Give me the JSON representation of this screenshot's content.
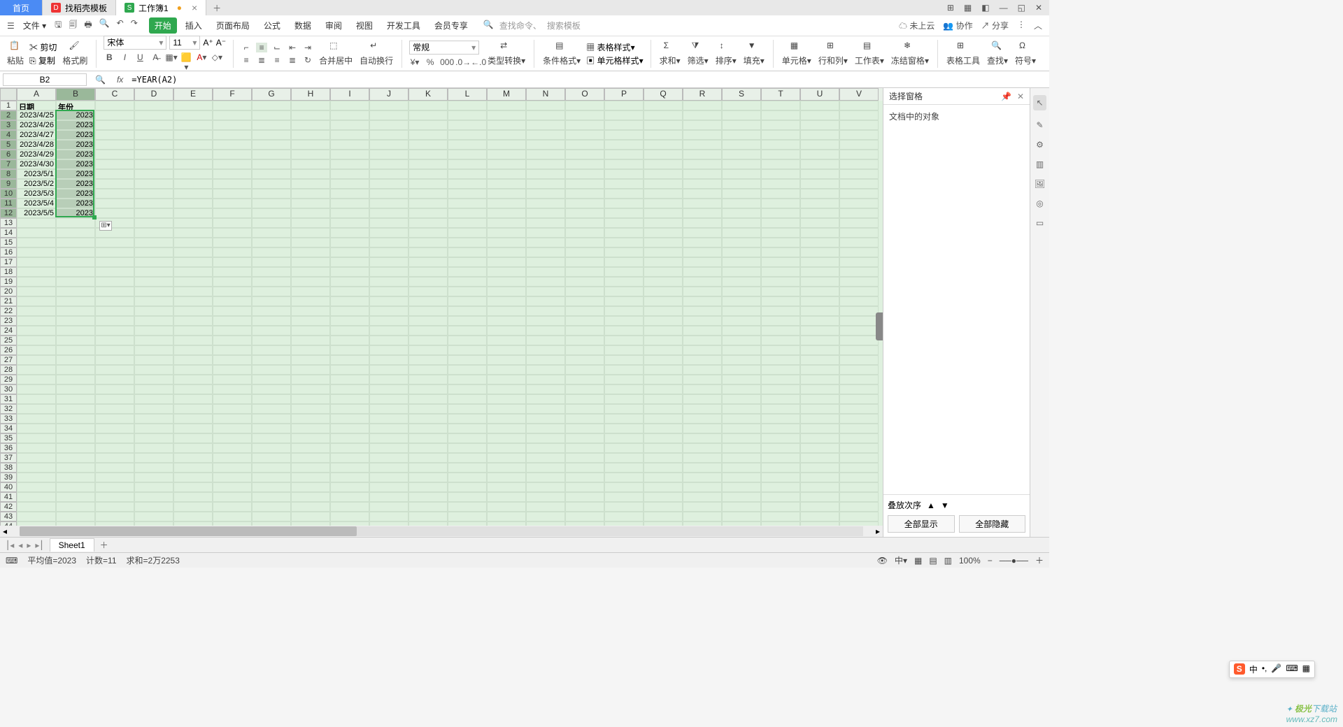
{
  "titlebar": {
    "tabs": [
      {
        "label": "首页",
        "kind": "home"
      },
      {
        "label": "找稻壳模板",
        "kind": "docer"
      },
      {
        "label": "工作簿1",
        "kind": "sheet",
        "dirty": true
      }
    ],
    "window_icons": [
      "⊞",
      "⊡",
      "◧",
      "—",
      "◱",
      "✕"
    ]
  },
  "menubar": {
    "file": "文件",
    "items": [
      "开始",
      "插入",
      "页面布局",
      "公式",
      "数据",
      "审阅",
      "视图",
      "开发工具",
      "会员专享"
    ],
    "active": "开始",
    "search_cmd": "查找命令、",
    "search_tpl": "搜索模板",
    "cloud": "未上云",
    "collab": "协作",
    "share": "分享"
  },
  "ribbon": {
    "paste": "粘贴",
    "cut": "剪切",
    "copy": "复制",
    "format_painter": "格式刷",
    "font_name": "宋体",
    "font_size": "11",
    "merge": "合并居中",
    "wrap": "自动换行",
    "number_format": "常规",
    "type_convert": "类型转换",
    "cond_fmt": "条件格式",
    "table_style": "表格样式",
    "cell_style": "单元格样式",
    "sum": "求和",
    "filter": "筛选",
    "sort": "排序",
    "fill": "填充",
    "cells": "单元格",
    "rowcol": "行和列",
    "worksheet": "工作表",
    "freeze": "冻结窗格",
    "table_tools": "表格工具",
    "find": "查找",
    "symbol": "符号"
  },
  "namebox": {
    "cell": "B2",
    "formula": "=YEAR(A2)"
  },
  "columns": [
    "A",
    "B",
    "C",
    "D",
    "E",
    "F",
    "G",
    "H",
    "I",
    "J",
    "K",
    "L",
    "M",
    "N",
    "O",
    "P",
    "Q",
    "R",
    "S",
    "T",
    "U",
    "V"
  ],
  "selected_col": "B",
  "selection": {
    "range": "B2:B12"
  },
  "rows": [
    {
      "n": 1,
      "A": "日期",
      "B": "年份"
    },
    {
      "n": 2,
      "A": "2023/4/25",
      "B": "2023"
    },
    {
      "n": 3,
      "A": "2023/4/26",
      "B": "2023"
    },
    {
      "n": 4,
      "A": "2023/4/27",
      "B": "2023"
    },
    {
      "n": 5,
      "A": "2023/4/28",
      "B": "2023"
    },
    {
      "n": 6,
      "A": "2023/4/29",
      "B": "2023"
    },
    {
      "n": 7,
      "A": "2023/4/30",
      "B": "2023"
    },
    {
      "n": 8,
      "A": "2023/5/1",
      "B": "2023"
    },
    {
      "n": 9,
      "A": "2023/5/2",
      "B": "2023"
    },
    {
      "n": 10,
      "A": "2023/5/3",
      "B": "2023"
    },
    {
      "n": 11,
      "A": "2023/5/4",
      "B": "2023"
    },
    {
      "n": 12,
      "A": "2023/5/5",
      "B": "2023"
    }
  ],
  "total_rows": 44,
  "sidepanel": {
    "title": "选择窗格",
    "body": "文档中的对象",
    "stack": "叠放次序",
    "show_all": "全部显示",
    "hide_all": "全部隐藏"
  },
  "sheets": {
    "active": "Sheet1"
  },
  "status": {
    "avg": "平均值=2023",
    "count": "计数=11",
    "sum": "求和=2万2253",
    "zoom": "100%"
  },
  "ime": {
    "lang": "中"
  },
  "watermark": {
    "brand": "极光",
    "text": "下载站",
    "url": "www.xz7.com"
  }
}
